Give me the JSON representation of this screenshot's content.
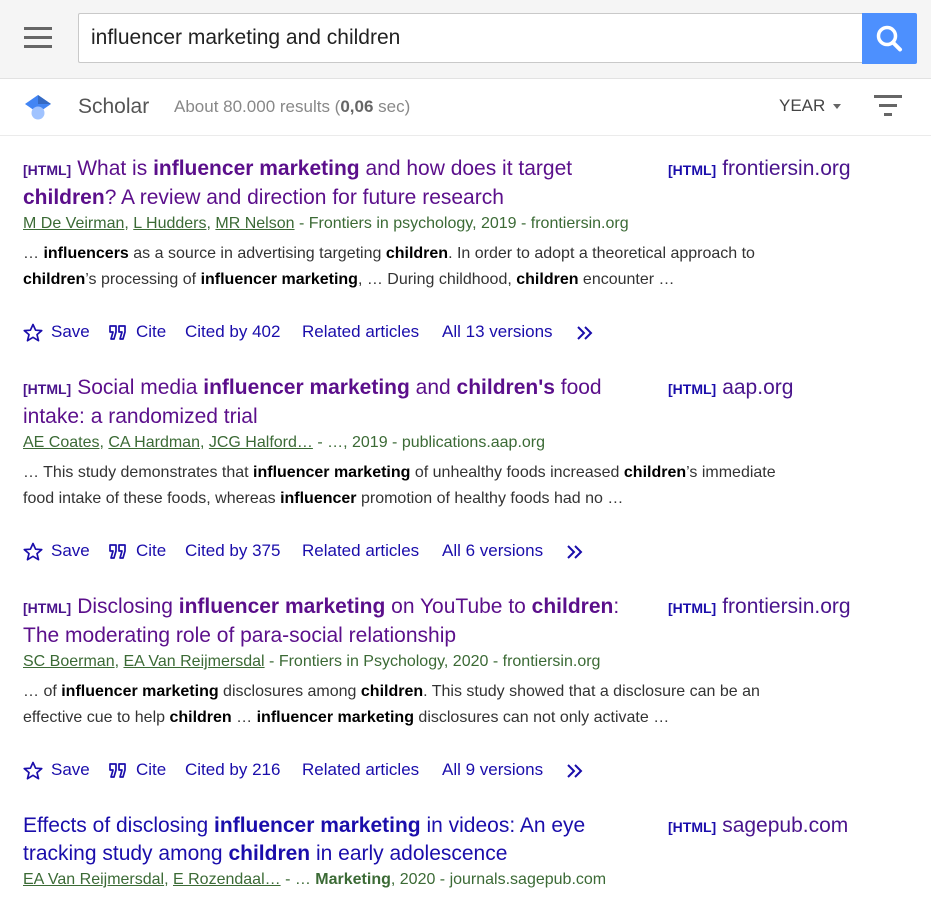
{
  "search": {
    "query": "influencer marketing and children"
  },
  "header": {
    "brand": "Scholar",
    "count_prefix": "About 80.000 results (",
    "count_time": "0,06",
    "count_suffix": " sec)",
    "year_label": "YEAR"
  },
  "actions": {
    "save": "Save",
    "cite": "Cite",
    "related": "Related articles"
  },
  "colors": {
    "search_button": "#4d90fe",
    "visited_title": "#5b0f8b",
    "link": "#1a0dab",
    "meta_green": "#3b6a35"
  },
  "results": [
    {
      "tag": "[HTML]",
      "title": [
        "What is ",
        "influencer marketing",
        " and how does it target ",
        "children",
        "? A review and direction for future research"
      ],
      "side_tag": "[HTML]",
      "side_domain": "frontiersin.org",
      "authors": [
        "M De Veirman",
        "L Hudders",
        "MR Nelson"
      ],
      "source": " - Frontiers in psychology, 2019 - frontiersin.org",
      "snippet": [
        "… ",
        "influencers",
        " as a source in advertising targeting ",
        "children",
        ". In order to adopt a theoretical approach to ",
        "children",
        "’s processing of ",
        "influencer marketing",
        ", … During childhood, ",
        "children",
        " encounter …"
      ],
      "cited_by": "Cited by 402",
      "versions": "All 13 versions"
    },
    {
      "tag": "[HTML]",
      "title": [
        "Social media ",
        "influencer marketing",
        " and ",
        "children's",
        " food intake: a randomized trial"
      ],
      "side_tag": "[HTML]",
      "side_domain": "aap.org",
      "authors": [
        "AE Coates",
        "CA Hardman",
        "JCG Halford…"
      ],
      "source": " - …, 2019 - publications.aap.org",
      "snippet": [
        "… This study demonstrates that ",
        "influencer marketing",
        " of unhealthy foods increased ",
        "children",
        "’s immediate food intake of these foods, whereas ",
        "influencer",
        " promotion of healthy foods had no …"
      ],
      "cited_by": "Cited by 375",
      "versions": "All 6 versions"
    },
    {
      "tag": "[HTML]",
      "title": [
        "Disclosing ",
        "influencer marketing",
        " on YouTube to ",
        "children",
        ": The moderating role of para-social relationship"
      ],
      "side_tag": "[HTML]",
      "side_domain": "frontiersin.org",
      "authors": [
        "SC Boerman",
        "EA Van Reijmersdal"
      ],
      "source": " - Frontiers in Psychology, 2020 - frontiersin.org",
      "snippet": [
        "… of ",
        "influencer marketing",
        " disclosures among ",
        "children",
        ". This study showed that a disclosure can be an effective cue to help ",
        "children",
        " … ",
        "influencer marketing",
        " disclosures can not only activate …"
      ],
      "cited_by": "Cited by 216",
      "versions": "All 9 versions"
    },
    {
      "tag": "",
      "title": [
        "Effects of disclosing ",
        "influencer marketing",
        " in videos: An eye tracking study among ",
        "children",
        " in early adolescence"
      ],
      "side_tag": "[HTML]",
      "side_domain": "sagepub.com",
      "authors": [
        "EA Van Reijmersdal",
        "E Rozendaal…"
      ],
      "source_parts": [
        " - … ",
        "Marketing",
        ", 2020 - journals.sagepub.com"
      ]
    }
  ]
}
